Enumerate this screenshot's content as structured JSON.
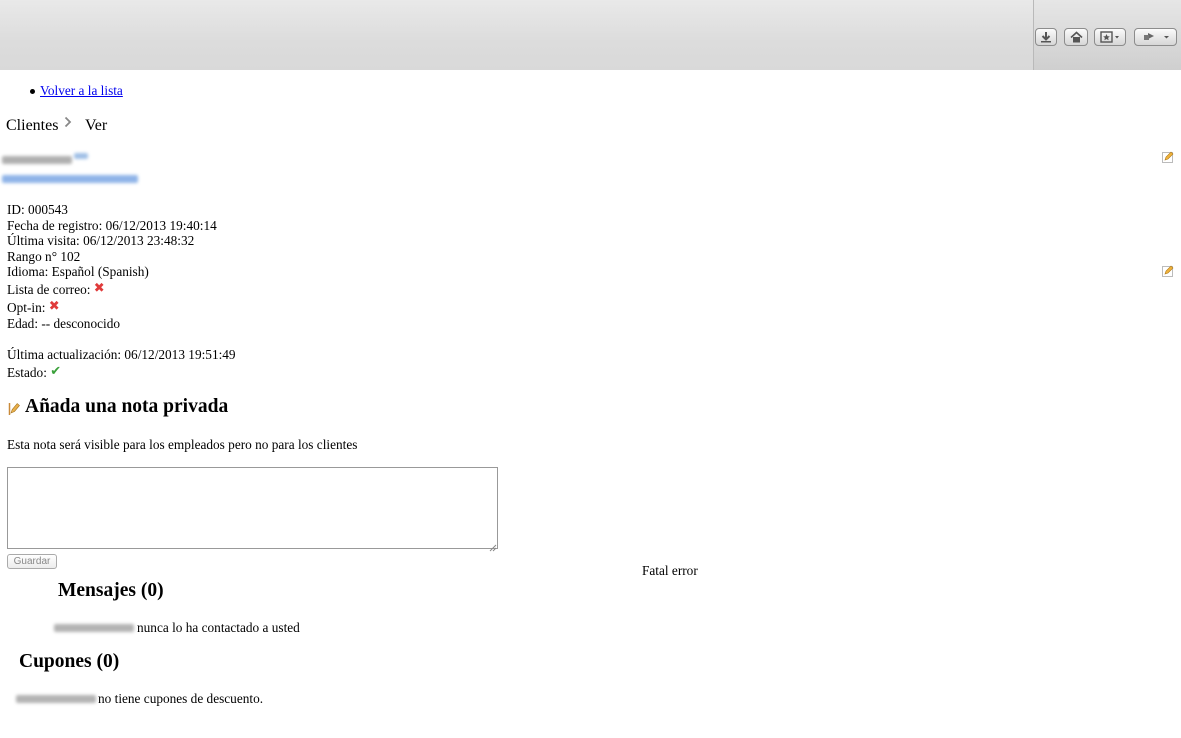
{
  "toolbar": {
    "download_icon": "download-icon",
    "home_icon": "home-icon",
    "bookmark_icon": "bookmark-icon",
    "extension_icon": "extension-icon"
  },
  "nav": {
    "back_link": "Volver a la lista"
  },
  "breadcrumb": {
    "parent": "Clientes",
    "current": "Ver"
  },
  "customer": {
    "id": "ID: 000543",
    "registered": "Fecha de registro: 06/12/2013 19:40:14",
    "last_visit": "Última visita: 06/12/2013 23:48:32",
    "rank": "Rango n° 102",
    "language": "Idioma: Español (Spanish)",
    "mailing_list": "Lista de correo:",
    "opt_in": "Opt-in:",
    "age": "Edad: -- desconocido",
    "last_update": "Última actualización: 06/12/2013 19:51:49",
    "status": "Estado:"
  },
  "note": {
    "title": "Añada una nota privada",
    "description": "Esta nota será visible para los empleados pero no para los clientes",
    "textarea_value": "",
    "save_label": "Guardar"
  },
  "error": {
    "text": "Fatal error"
  },
  "messages": {
    "title": "Mensajes (0)",
    "text": "nunca lo ha contactado a usted"
  },
  "coupons": {
    "title": "Cupones (0)",
    "text": "no tiene cupones de descuento."
  },
  "colors": {
    "link": "#0000ee",
    "error_x": "#e03b3b",
    "check": "#3aa03a"
  }
}
